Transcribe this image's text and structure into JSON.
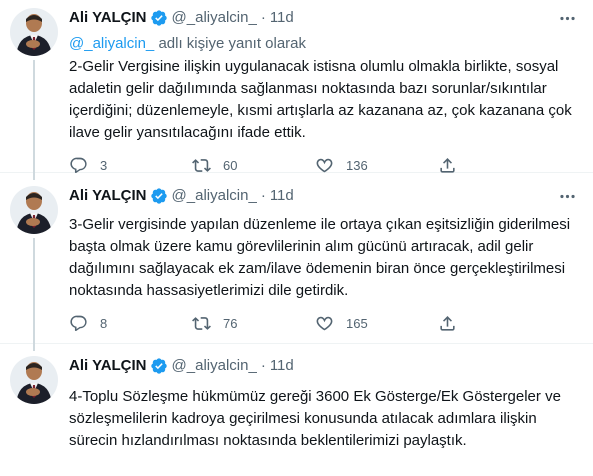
{
  "tweets": [
    {
      "author_name": "Ali YALÇIN",
      "handle": "@_aliyalcin_",
      "separator": "·",
      "time": "11d",
      "reply_prefix": "@_aliyalcin_",
      "reply_suffix": " adlı kişiye yanıt olarak",
      "text": "2-Gelir Vergisine ilişkin uygulanacak istisna olumlu olmakla birlikte, sosyal\nadaletin gelir dağılımında sağlanması noktasında bazı sorunlar/sıkıntılar\niçerdiğini; düzenlemeyle, kısmi artışlarla az kazanana az, çok kazanana çok\nilave gelir yansıtılacağını ifade ettik.",
      "replies": "3",
      "retweets": "60",
      "likes": "136"
    },
    {
      "author_name": "Ali YALÇIN",
      "handle": "@_aliyalcin_",
      "separator": "·",
      "time": "11d",
      "text": "3-Gelir vergisinde yapılan düzenleme ile ortaya çıkan eşitsizliğin giderilmesi\nbaşta olmak üzere kamu görevlilerinin alım gücünü artıracak, adil gelir\ndağılımını sağlayacak ek zam/ilave ödemenin biran önce gerçekleştirilmesi\nnoktasında hassasiyetlerimizi dile getirdik.",
      "replies": "8",
      "retweets": "76",
      "likes": "165"
    },
    {
      "author_name": "Ali YALÇIN",
      "handle": "@_aliyalcin_",
      "separator": "·",
      "time": "11d",
      "text": "4-Toplu Sözleşme hükmümüz gereği 3600 Ek Gösterge/Ek Göstergeler ve\nsözleşmelilerin kadroya geçirilmesi konusunda atılacak adımlara ilişkin\nsürecin hızlandırılması noktasında beklentilerimizi paylaştık.\n\nEk zam dahil tekliflerimiz için Çalışma Bakanı ile bir araya geleceğiz."
    }
  ],
  "icons": {
    "verified": "verified-badge-icon",
    "more": "more-icon",
    "reply": "reply-icon",
    "retweet": "retweet-icon",
    "like": "heart-icon",
    "share": "share-icon"
  },
  "colors": {
    "accent": "#1d9bf0",
    "secondary_text": "#536471",
    "divider": "#eff3f4"
  }
}
